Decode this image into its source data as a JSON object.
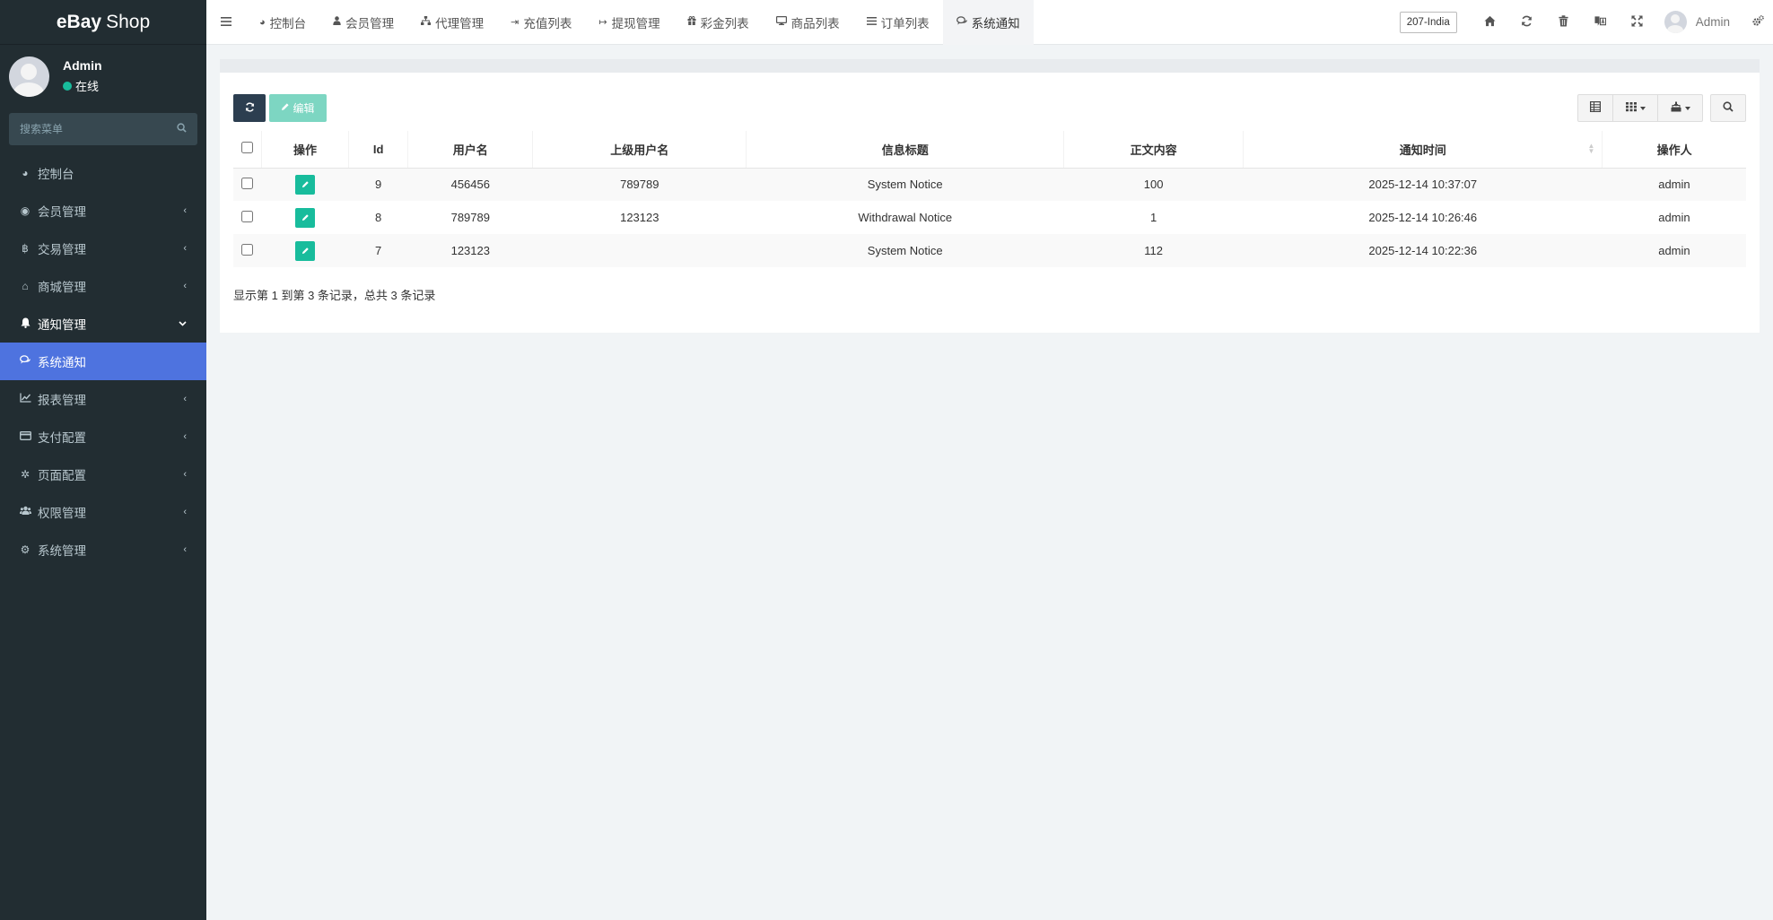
{
  "sidebar": {
    "logo": {
      "bold": "eBay",
      "rest": "Shop"
    },
    "user": {
      "name": "Admin",
      "status": "在线"
    },
    "search": {
      "placeholder": "搜索菜单"
    },
    "items": [
      {
        "label": "控制台",
        "icon": "dashboard-icon"
      },
      {
        "label": "会员管理",
        "icon": "user-circle-icon"
      },
      {
        "label": "交易管理",
        "icon": "bitcoin-icon"
      },
      {
        "label": "商城管理",
        "icon": "home-icon"
      },
      {
        "label": "通知管理",
        "icon": "bell-icon"
      },
      {
        "label": "系统通知",
        "icon": "comments-icon"
      },
      {
        "label": "报表管理",
        "icon": "line-chart-icon"
      },
      {
        "label": "支付配置",
        "icon": "credit-card-icon"
      },
      {
        "label": "页面配置",
        "icon": "gear-icon"
      },
      {
        "label": "权限管理",
        "icon": "group-icon"
      },
      {
        "label": "系统管理",
        "icon": "cogs-icon"
      }
    ]
  },
  "header": {
    "tabs": [
      {
        "label": "控制台",
        "icon": "dashboard-icon"
      },
      {
        "label": "会员管理",
        "icon": "user-icon"
      },
      {
        "label": "代理管理",
        "icon": "sitemap-icon"
      },
      {
        "label": "充值列表",
        "icon": "sign-in-icon"
      },
      {
        "label": "提现管理",
        "icon": "sign-out-icon"
      },
      {
        "label": "彩金列表",
        "icon": "gift-icon"
      },
      {
        "label": "商品列表",
        "icon": "desktop-icon"
      },
      {
        "label": "订单列表",
        "icon": "list-icon"
      },
      {
        "label": "系统通知",
        "icon": "comments-icon"
      }
    ],
    "region": "207-India",
    "user_name": "Admin"
  },
  "toolbar": {
    "edit_label": "编辑"
  },
  "table": {
    "columns": [
      "操作",
      "Id",
      "用户名",
      "上级用户名",
      "信息标题",
      "正文内容",
      "通知时间",
      "操作人"
    ],
    "rows": [
      {
        "id": "9",
        "username": "456456",
        "parent": "789789",
        "title": "System Notice",
        "content": "100",
        "time": "2025-12-14 10:37:07",
        "operator": "admin"
      },
      {
        "id": "8",
        "username": "789789",
        "parent": "123123",
        "title": "Withdrawal Notice",
        "content": "1",
        "time": "2025-12-14 10:26:46",
        "operator": "admin"
      },
      {
        "id": "7",
        "username": "123123",
        "parent": "",
        "title": "System Notice",
        "content": "112",
        "time": "2025-12-14 10:22:36",
        "operator": "admin"
      }
    ]
  },
  "pager": {
    "info": "显示第 1 到第 3 条记录，总共 3 条记录"
  },
  "colors": {
    "sidebar_bg": "#222d32",
    "active_menu": "#4e73df",
    "edit_green": "#18bc9c",
    "refresh_dark": "#2c3e50"
  }
}
